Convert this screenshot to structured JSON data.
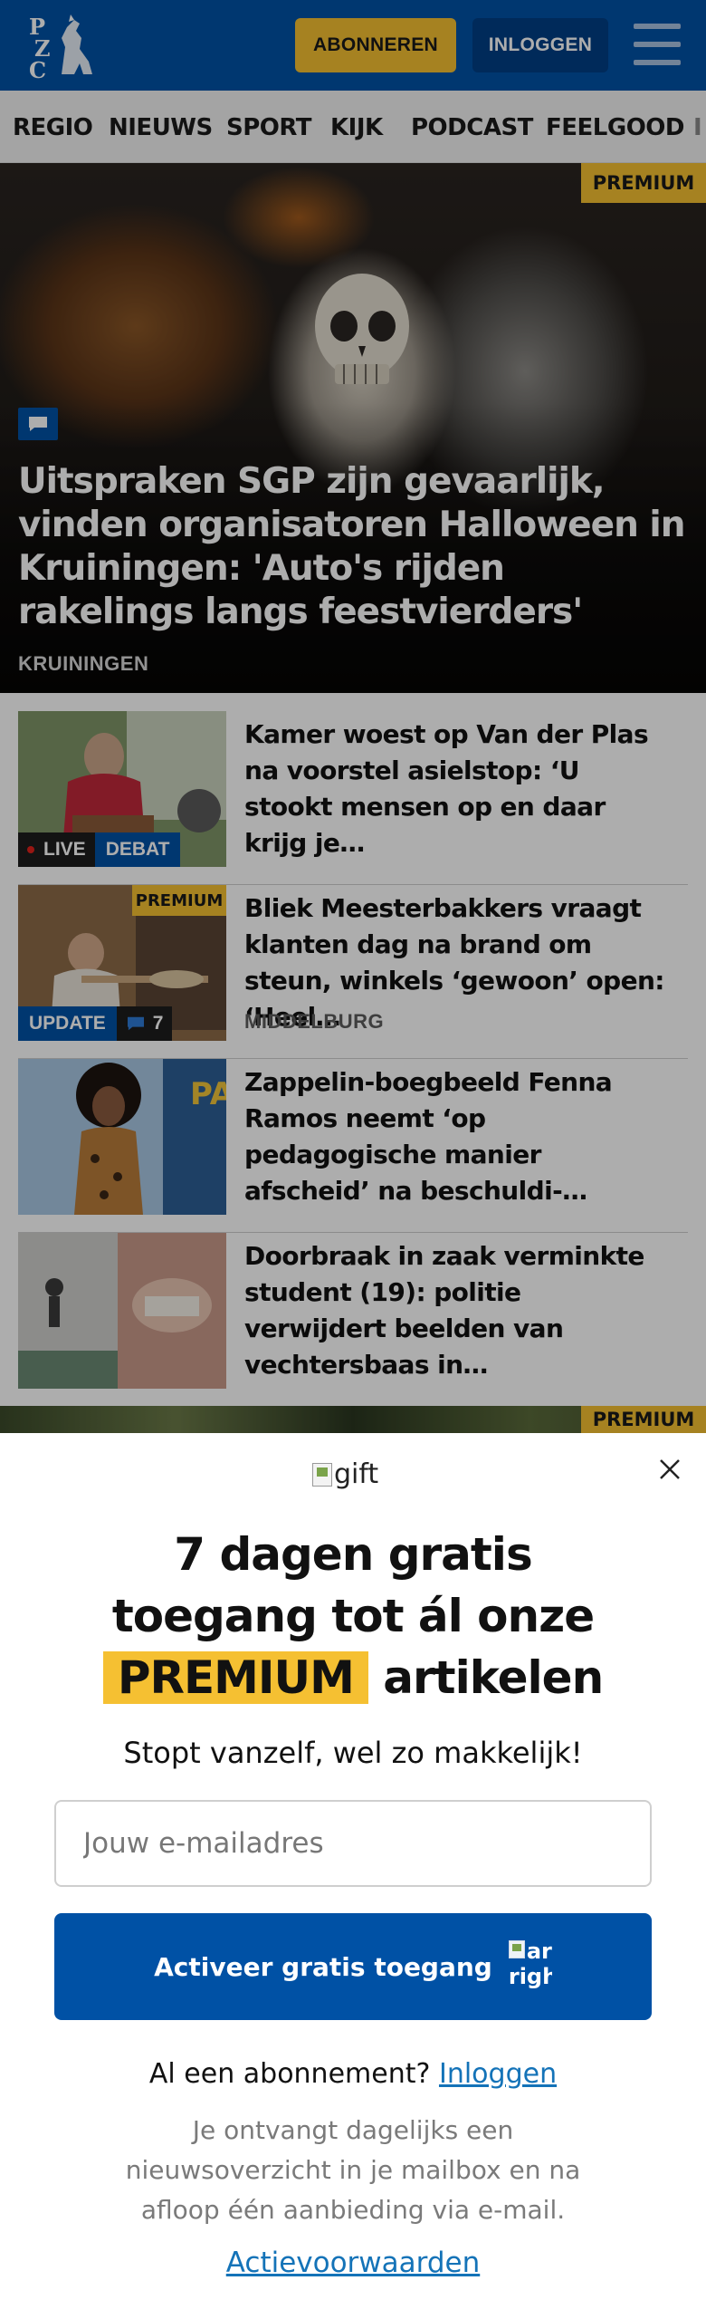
{
  "header": {
    "logo_alt": "PZC",
    "subscribe_label": "ABONNEREN",
    "login_label": "INLOGGEN",
    "menu_icon": "hamburger-menu-icon",
    "brand_color": "#0051a5",
    "accent_color": "#f5c032"
  },
  "nav": {
    "items": [
      "REGIO",
      "NIEUWS",
      "SPORT",
      "KIJK",
      "PODCAST",
      "FEELGOOD",
      "I"
    ]
  },
  "hero": {
    "premium_label": "PREMIUM",
    "title": "Uitspraken SGP zijn gevaarlijk, vinden organisatoren Halloween in Kruiningen: 'Auto's rijden rakelings langs feestvierders'",
    "location": "KRUININGEN"
  },
  "articles": [
    {
      "title": "Kamer woest op Van der Plas na voorstel asielstop: ‘U stookt mensen op en daar krijg je…",
      "live_label": "LIVE",
      "tag_label": "DEBAT"
    },
    {
      "title": "Bliek Meesterbakkers vraagt klanten dag na brand om steun, winkels ‘gewoon’ open: ‘Heel…",
      "location": "MIDDELBURG",
      "premium_label": "PREMIUM",
      "update_label": "UPDATE",
      "comment_count": "7"
    },
    {
      "title": "Zappelin-boegbeeld Fenna Ramos neemt ‘op pedagogische manier afscheid’ na beschuldi-…"
    },
    {
      "title": "Doorbraak in zaak verminkte student (19): politie verwijdert beelden van vechtersbaas in…"
    }
  ],
  "next_strip": {
    "premium_label": "PREMIUM"
  },
  "modal": {
    "gift_alt": "gift",
    "headline_line1": "7 dagen gratis",
    "headline_line2": "toegang tot ál onze",
    "headline_highlight": "PREMIUM",
    "headline_tail": "artikelen",
    "subline": "Stopt vanzelf, wel zo makkelijk!",
    "email_placeholder": "Jouw e-mailadres",
    "email_value": "",
    "cta_label": "Activeer gratis toegang",
    "cta_icon_alt_line1": "arro",
    "cta_icon_alt_line2": "righ",
    "already_text": "Al een abonnement?",
    "already_link": "Inloggen",
    "info_text": "Je ontvangt dagelijks een nieuwsoverzicht in je mailbox en na afloop één aanbieding via e-mail.",
    "terms_link": "Actievoorwaarden"
  }
}
